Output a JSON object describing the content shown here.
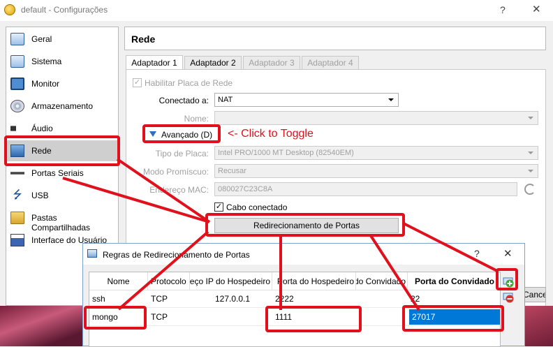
{
  "window": {
    "title": "default - Configurações",
    "help": "?",
    "close": "✕"
  },
  "sidebar": {
    "items": [
      {
        "label": "Geral",
        "icon": "general-icon"
      },
      {
        "label": "Sistema",
        "icon": "system-icon"
      },
      {
        "label": "Monitor",
        "icon": "monitor-icon"
      },
      {
        "label": "Armazenamento",
        "icon": "storage-icon"
      },
      {
        "label": "Áudio",
        "icon": "audio-icon"
      },
      {
        "label": "Rede",
        "icon": "network-icon",
        "active": true
      },
      {
        "label": "Portas Seriais",
        "icon": "serial-ports-icon"
      },
      {
        "label": "USB",
        "icon": "usb-icon"
      },
      {
        "label": "Pastas Compartilhadas",
        "icon": "shared-folders-icon"
      },
      {
        "label": "Interface do Usuário",
        "icon": "user-interface-icon"
      }
    ]
  },
  "content": {
    "title": "Rede",
    "tabs": [
      "Adaptador 1",
      "Adaptador 2",
      "Adaptador 3",
      "Adaptador 4"
    ],
    "enable_label": "Habilitar Placa de Rede",
    "connected_label": "Conectado a:",
    "connected_value": "NAT",
    "name_label": "Nome:",
    "advanced_label": "Avançado (D)",
    "adapter_type_label": "Tipo de Placa:",
    "adapter_type_value": "Intel PRO/1000 MT Desktop (82540EM)",
    "promisc_label": "Modo Promíscuo:",
    "promisc_value": "Recusar",
    "mac_label": "Endereço MAC:",
    "mac_value": "080027C23C8A",
    "cable_label": "Cabo conectado",
    "port_forward_button": "Redirecionamento de Portas",
    "cancel_peek": "Cancel"
  },
  "annotation": {
    "toggle_note": "<- Click to Toggle"
  },
  "dialog": {
    "title": "Regras de Redirecionamento de Portas",
    "help": "?",
    "close": "✕",
    "columns": [
      "Nome",
      "Protocolo",
      "Endereço IP do Hospedeiro",
      "Porta do Hospedeiro",
      "Endereço IP do Convidado",
      "Porta do Convidado"
    ],
    "rows": [
      [
        "ssh",
        "TCP",
        "127.0.0.1",
        "2222",
        "",
        "22"
      ],
      [
        "mongo",
        "TCP",
        "",
        "1111",
        "",
        "27017"
      ]
    ]
  },
  "colors": {
    "annotation_red": "#e0101c",
    "selection_blue": "#0078d7",
    "accent_blue": "#2e6fbf"
  }
}
